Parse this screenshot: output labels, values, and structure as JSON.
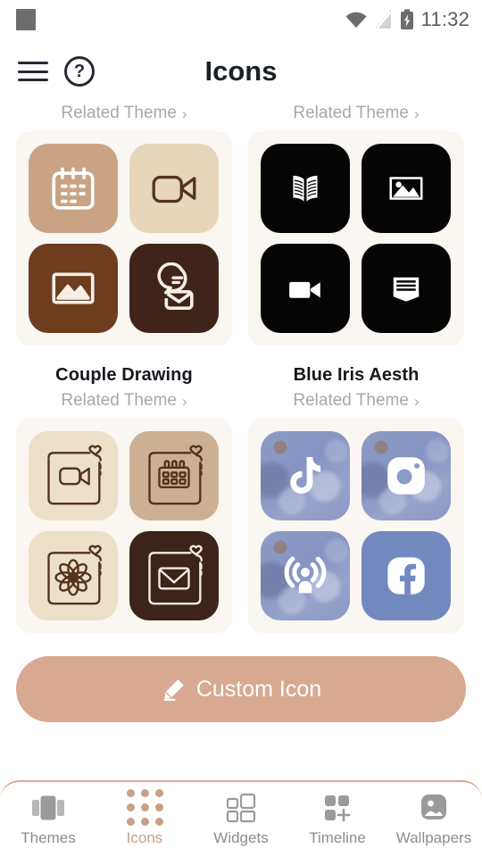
{
  "statusbar": {
    "time": "11:32",
    "icons": [
      "app-square-icon",
      "wifi-icon",
      "signal-icon",
      "battery-charging-icon"
    ]
  },
  "header": {
    "title": "Icons",
    "menu_icon": "hamburger-menu-icon",
    "help_icon": "help-circle-icon"
  },
  "themes": [
    {
      "title": "",
      "related_label": "Related Theme",
      "chevron": "›",
      "tiles": [
        {
          "name": "calendar",
          "tile_color": "#c9a484",
          "icon_color": "#ffffff"
        },
        {
          "name": "video-camera",
          "tile_color": "#e7d6ba",
          "icon_color": "#55331f"
        },
        {
          "name": "gallery",
          "tile_color": "#6d3d1e",
          "icon_color": "#f7efe6"
        },
        {
          "name": "messages",
          "tile_color": "#40241a",
          "icon_color": "#f7efe6"
        }
      ]
    },
    {
      "title": "",
      "related_label": "Related Theme",
      "chevron": "›",
      "tiles": [
        {
          "name": "book",
          "tile_color": "#050505",
          "icon_color": "#ffffff"
        },
        {
          "name": "photos",
          "tile_color": "#050505",
          "icon_color": "#ffffff"
        },
        {
          "name": "video-camera",
          "tile_color": "#050505",
          "icon_color": "#ffffff"
        },
        {
          "name": "mail-inbox",
          "tile_color": "#050505",
          "icon_color": "#ffffff"
        }
      ]
    },
    {
      "title": "Couple Drawing",
      "related_label": "Related Theme",
      "chevron": "›",
      "tiles": [
        {
          "name": "video-camera-sketch",
          "tile_color": "#ece0c8",
          "icon_color": "#54331d"
        },
        {
          "name": "calendar-sketch",
          "tile_color": "#cdb093",
          "icon_color": "#54331d"
        },
        {
          "name": "flower-sketch",
          "tile_color": "#ece0c8",
          "icon_color": "#54331d"
        },
        {
          "name": "envelope-sketch",
          "tile_color": "#3d2319",
          "icon_color": "#f3ece1"
        }
      ]
    },
    {
      "title": "Blue Iris Aesth",
      "related_label": "Related Theme",
      "chevron": "›",
      "tiles": [
        {
          "name": "tiktok",
          "tile_color": "photo-iris",
          "icon_color": "#ffffff"
        },
        {
          "name": "instagram",
          "tile_color": "photo-iris",
          "icon_color": "#ffffff"
        },
        {
          "name": "podcast",
          "tile_color": "photo-iris",
          "icon_color": "#ffffff"
        },
        {
          "name": "facebook",
          "tile_color": "#7289c0",
          "icon_color": "#ffffff"
        }
      ]
    }
  ],
  "custom_button": {
    "label": "Custom Icon",
    "icon": "pencil-icon",
    "background": "#d7a991"
  },
  "bottom_nav": {
    "active": "Icons",
    "accent": "#c8a085",
    "inactive": "#8d8d8d",
    "items": [
      {
        "label": "Themes",
        "icon": "carousel-icon"
      },
      {
        "label": "Icons",
        "icon": "dots-grid-icon"
      },
      {
        "label": "Widgets",
        "icon": "squares-outline-icon"
      },
      {
        "label": "Timeline",
        "icon": "squares-plus-icon"
      },
      {
        "label": "Wallpapers",
        "icon": "wallpaper-image-icon"
      }
    ]
  }
}
